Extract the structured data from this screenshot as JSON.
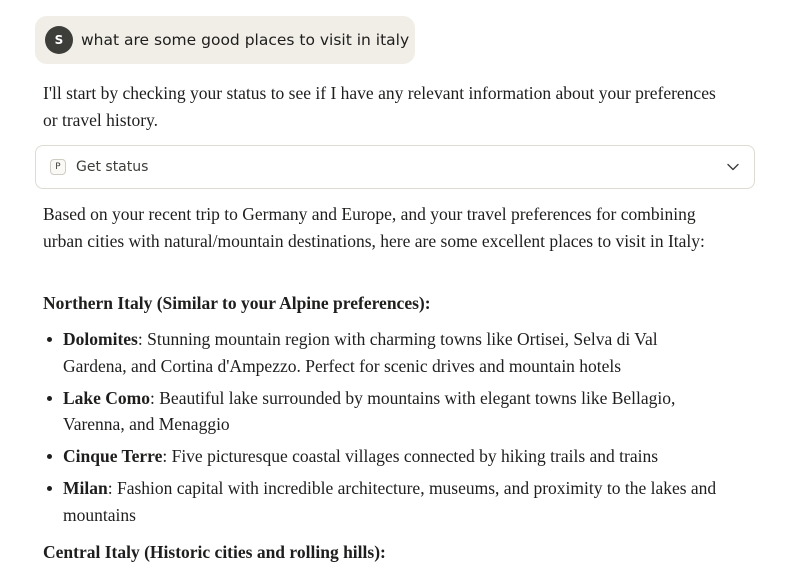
{
  "user_message": {
    "avatar_initial": "S",
    "text": "what are some good places to visit in italy"
  },
  "assistant": {
    "intro": "I'll start by checking your status to see if I have any relevant information about your preferences or travel history.",
    "tool_call": {
      "icon_letter": "P",
      "label": "Get status",
      "expand_icon": "chevron-down-icon"
    },
    "based_on": "Based on your recent trip to Germany and Europe, and your travel preferences for combining urban cities with natural/mountain destinations, here are some excellent places to visit in Italy:",
    "northern_heading": "Northern Italy (Similar to your Alpine preferences):",
    "northern_places": [
      {
        "name": "Dolomites",
        "desc": ": Stunning mountain region with charming towns like Ortisei, Selva di Val Gardena, and Cortina d'Ampezzo. Perfect for scenic drives and mountain hotels"
      },
      {
        "name": "Lake Como",
        "desc": ": Beautiful lake surrounded by mountains with elegant towns like Bellagio, Varenna, and Menaggio"
      },
      {
        "name": "Cinque Terre",
        "desc": ": Five picturesque coastal villages connected by hiking trails and trains"
      },
      {
        "name": "Milan",
        "desc": ": Fashion capital with incredible architecture, museums, and proximity to the lakes and mountains"
      }
    ],
    "central_heading": "Central Italy (Historic cities and rolling hills):"
  }
}
